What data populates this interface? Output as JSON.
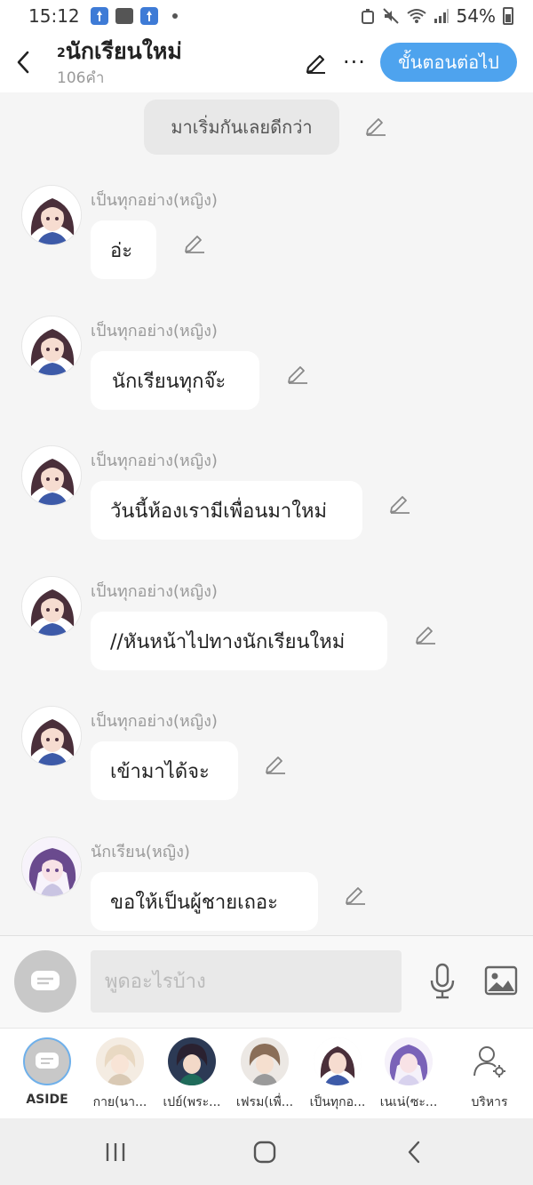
{
  "status_bar": {
    "time": "15:12",
    "battery": "54%"
  },
  "header": {
    "title_prefix": "2",
    "title": "นักเรียนใหม่",
    "subtitle": "106คำ",
    "next_button": "ขั้นตอนต่อไป",
    "more_label": "···"
  },
  "chat": {
    "system_message": "มาเริ่มกันเลยดีกว่า",
    "messages": [
      {
        "speaker": "เป็นทุกอย่าง(หญิง)",
        "text": "อ่ะ"
      },
      {
        "speaker": "เป็นทุกอย่าง(หญิง)",
        "text": "นักเรียนทุกจ๊ะ"
      },
      {
        "speaker": "เป็นทุกอย่าง(หญิง)",
        "text": "วันนี้ห้องเรามีเพื่อนมาใหม่"
      },
      {
        "speaker": "เป็นทุกอย่าง(หญิง)",
        "text": "//หันหน้าไปทางนักเรียนใหม่"
      },
      {
        "speaker": "เป็นทุกอย่าง(หญิง)",
        "text": "เข้ามาได้จะ"
      },
      {
        "speaker": "นักเรียน(หญิง)",
        "text": "ขอให้เป็นผู้ชายเถอะ"
      }
    ]
  },
  "input": {
    "placeholder": "พูดอะไรบ้าง"
  },
  "characters": {
    "aside": "ASIDE",
    "items": [
      {
        "label": "กาย(นา..."
      },
      {
        "label": "เปย์(พระ..."
      },
      {
        "label": "เฟรม(เพื่..."
      },
      {
        "label": "เป็นทุกอ..."
      },
      {
        "label": "เนเน่(ซะ..."
      }
    ],
    "manage": "บริหาร"
  },
  "colors": {
    "accent": "#4ea3ee",
    "bubble": "#ffffff",
    "background": "#f5f5f5"
  }
}
